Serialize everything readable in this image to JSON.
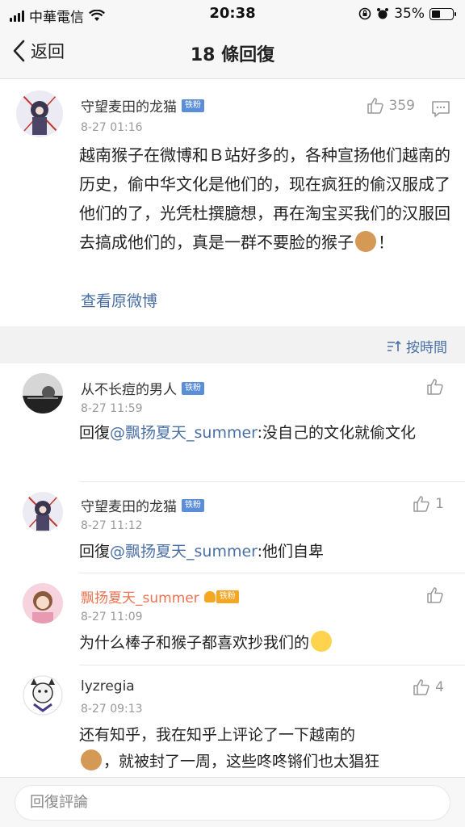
{
  "status": {
    "carrier": "中華電信",
    "time": "20:38",
    "battery": "35%"
  },
  "nav": {
    "back_label": "返回",
    "title": "18 條回復"
  },
  "main_post": {
    "username": "守望麦田的龙猫",
    "badge": "铁粉",
    "likes": "359",
    "timestamp": "8-27 01:16",
    "text_before_emoji": "越南猴子在微博和Ｂ站好多的，各种宣扬他们越南的历史，偷中华文化是他们的，现在疯狂的偷汉服成了他们的了，光凭杜撰臆想，再在淘宝买我们的汉服回去搞成他们的，真是一群不要脸的猴子",
    "emoji": "monkey-emoji",
    "text_after_emoji": "！",
    "view_original": "查看原微博"
  },
  "sort_label": "按時間",
  "replies": [
    {
      "username": "从不长痘的男人",
      "badge": "铁粉",
      "timestamp": "8-27 11:59",
      "reply_prefix": "回復",
      "mention": "@飘扬夏天_summer",
      "text": ":没自己的文化就偷文化",
      "likes": ""
    },
    {
      "username": "守望麦田的龙猫",
      "badge": "铁粉",
      "timestamp": "8-27 11:12",
      "reply_prefix": "回復",
      "mention": "@飘扬夏天_summer",
      "text": ":他们自卑",
      "likes": "1"
    },
    {
      "username": "飘扬夏天_summer",
      "badge": "铁粉",
      "timestamp": "8-27 11:09",
      "text": "为什么棒子和猴子都喜欢抄我们的",
      "emoji": "shush-face-emoji",
      "likes": ""
    },
    {
      "username": "lyzregia",
      "timestamp": "8-27 09:13",
      "text_line1": "还有知乎，我在知乎上评论了一下越南的",
      "emoji": "monkey-emoji",
      "text_line2": "，就被封了一周，这些咚咚锵们也太猖狂",
      "likes": "4"
    }
  ],
  "comment_placeholder": "回復評論",
  "colors": {
    "link": "#4a6fa5",
    "vip_orange": "#eb7350",
    "fan_badge": "#5b8ed9",
    "secondary_text": "#999999"
  }
}
